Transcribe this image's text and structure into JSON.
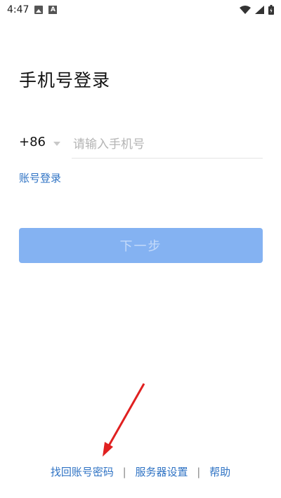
{
  "status_bar": {
    "time": "4:47"
  },
  "title": "手机号登录",
  "phone": {
    "country_code": "+86",
    "placeholder": "请输入手机号"
  },
  "account_login_link": "账号登录",
  "next_button_label": "下一步",
  "footer": {
    "recover_account": "找回账号密码",
    "separator": "|",
    "server_settings": "服务器设置",
    "help": "帮助"
  },
  "colors": {
    "link": "#2f73c4",
    "button_bg": "#84b2f2",
    "arrow": "#e02020"
  }
}
